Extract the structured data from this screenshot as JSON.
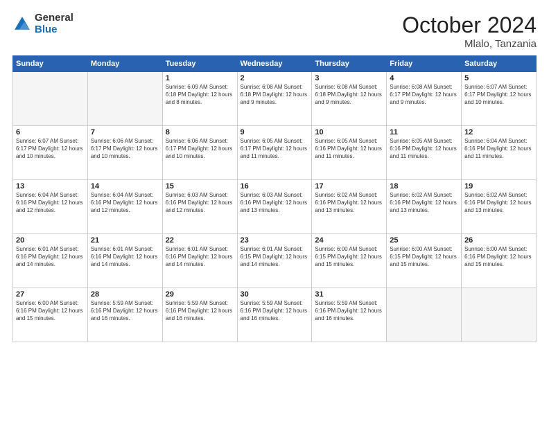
{
  "header": {
    "logo_general": "General",
    "logo_blue": "Blue",
    "month_title": "October 2024",
    "location": "Mlalo, Tanzania"
  },
  "days_of_week": [
    "Sunday",
    "Monday",
    "Tuesday",
    "Wednesday",
    "Thursday",
    "Friday",
    "Saturday"
  ],
  "weeks": [
    [
      {
        "day": "",
        "info": ""
      },
      {
        "day": "",
        "info": ""
      },
      {
        "day": "1",
        "info": "Sunrise: 6:09 AM\nSunset: 6:18 PM\nDaylight: 12 hours\nand 8 minutes."
      },
      {
        "day": "2",
        "info": "Sunrise: 6:08 AM\nSunset: 6:18 PM\nDaylight: 12 hours\nand 9 minutes."
      },
      {
        "day": "3",
        "info": "Sunrise: 6:08 AM\nSunset: 6:18 PM\nDaylight: 12 hours\nand 9 minutes."
      },
      {
        "day": "4",
        "info": "Sunrise: 6:08 AM\nSunset: 6:17 PM\nDaylight: 12 hours\nand 9 minutes."
      },
      {
        "day": "5",
        "info": "Sunrise: 6:07 AM\nSunset: 6:17 PM\nDaylight: 12 hours\nand 10 minutes."
      }
    ],
    [
      {
        "day": "6",
        "info": "Sunrise: 6:07 AM\nSunset: 6:17 PM\nDaylight: 12 hours\nand 10 minutes."
      },
      {
        "day": "7",
        "info": "Sunrise: 6:06 AM\nSunset: 6:17 PM\nDaylight: 12 hours\nand 10 minutes."
      },
      {
        "day": "8",
        "info": "Sunrise: 6:06 AM\nSunset: 6:17 PM\nDaylight: 12 hours\nand 10 minutes."
      },
      {
        "day": "9",
        "info": "Sunrise: 6:05 AM\nSunset: 6:17 PM\nDaylight: 12 hours\nand 11 minutes."
      },
      {
        "day": "10",
        "info": "Sunrise: 6:05 AM\nSunset: 6:16 PM\nDaylight: 12 hours\nand 11 minutes."
      },
      {
        "day": "11",
        "info": "Sunrise: 6:05 AM\nSunset: 6:16 PM\nDaylight: 12 hours\nand 11 minutes."
      },
      {
        "day": "12",
        "info": "Sunrise: 6:04 AM\nSunset: 6:16 PM\nDaylight: 12 hours\nand 11 minutes."
      }
    ],
    [
      {
        "day": "13",
        "info": "Sunrise: 6:04 AM\nSunset: 6:16 PM\nDaylight: 12 hours\nand 12 minutes."
      },
      {
        "day": "14",
        "info": "Sunrise: 6:04 AM\nSunset: 6:16 PM\nDaylight: 12 hours\nand 12 minutes."
      },
      {
        "day": "15",
        "info": "Sunrise: 6:03 AM\nSunset: 6:16 PM\nDaylight: 12 hours\nand 12 minutes."
      },
      {
        "day": "16",
        "info": "Sunrise: 6:03 AM\nSunset: 6:16 PM\nDaylight: 12 hours\nand 13 minutes."
      },
      {
        "day": "17",
        "info": "Sunrise: 6:02 AM\nSunset: 6:16 PM\nDaylight: 12 hours\nand 13 minutes."
      },
      {
        "day": "18",
        "info": "Sunrise: 6:02 AM\nSunset: 6:16 PM\nDaylight: 12 hours\nand 13 minutes."
      },
      {
        "day": "19",
        "info": "Sunrise: 6:02 AM\nSunset: 6:16 PM\nDaylight: 12 hours\nand 13 minutes."
      }
    ],
    [
      {
        "day": "20",
        "info": "Sunrise: 6:01 AM\nSunset: 6:16 PM\nDaylight: 12 hours\nand 14 minutes."
      },
      {
        "day": "21",
        "info": "Sunrise: 6:01 AM\nSunset: 6:16 PM\nDaylight: 12 hours\nand 14 minutes."
      },
      {
        "day": "22",
        "info": "Sunrise: 6:01 AM\nSunset: 6:16 PM\nDaylight: 12 hours\nand 14 minutes."
      },
      {
        "day": "23",
        "info": "Sunrise: 6:01 AM\nSunset: 6:15 PM\nDaylight: 12 hours\nand 14 minutes."
      },
      {
        "day": "24",
        "info": "Sunrise: 6:00 AM\nSunset: 6:15 PM\nDaylight: 12 hours\nand 15 minutes."
      },
      {
        "day": "25",
        "info": "Sunrise: 6:00 AM\nSunset: 6:15 PM\nDaylight: 12 hours\nand 15 minutes."
      },
      {
        "day": "26",
        "info": "Sunrise: 6:00 AM\nSunset: 6:16 PM\nDaylight: 12 hours\nand 15 minutes."
      }
    ],
    [
      {
        "day": "27",
        "info": "Sunrise: 6:00 AM\nSunset: 6:16 PM\nDaylight: 12 hours\nand 15 minutes."
      },
      {
        "day": "28",
        "info": "Sunrise: 5:59 AM\nSunset: 6:16 PM\nDaylight: 12 hours\nand 16 minutes."
      },
      {
        "day": "29",
        "info": "Sunrise: 5:59 AM\nSunset: 6:16 PM\nDaylight: 12 hours\nand 16 minutes."
      },
      {
        "day": "30",
        "info": "Sunrise: 5:59 AM\nSunset: 6:16 PM\nDaylight: 12 hours\nand 16 minutes."
      },
      {
        "day": "31",
        "info": "Sunrise: 5:59 AM\nSunset: 6:16 PM\nDaylight: 12 hours\nand 16 minutes."
      },
      {
        "day": "",
        "info": ""
      },
      {
        "day": "",
        "info": ""
      }
    ]
  ]
}
